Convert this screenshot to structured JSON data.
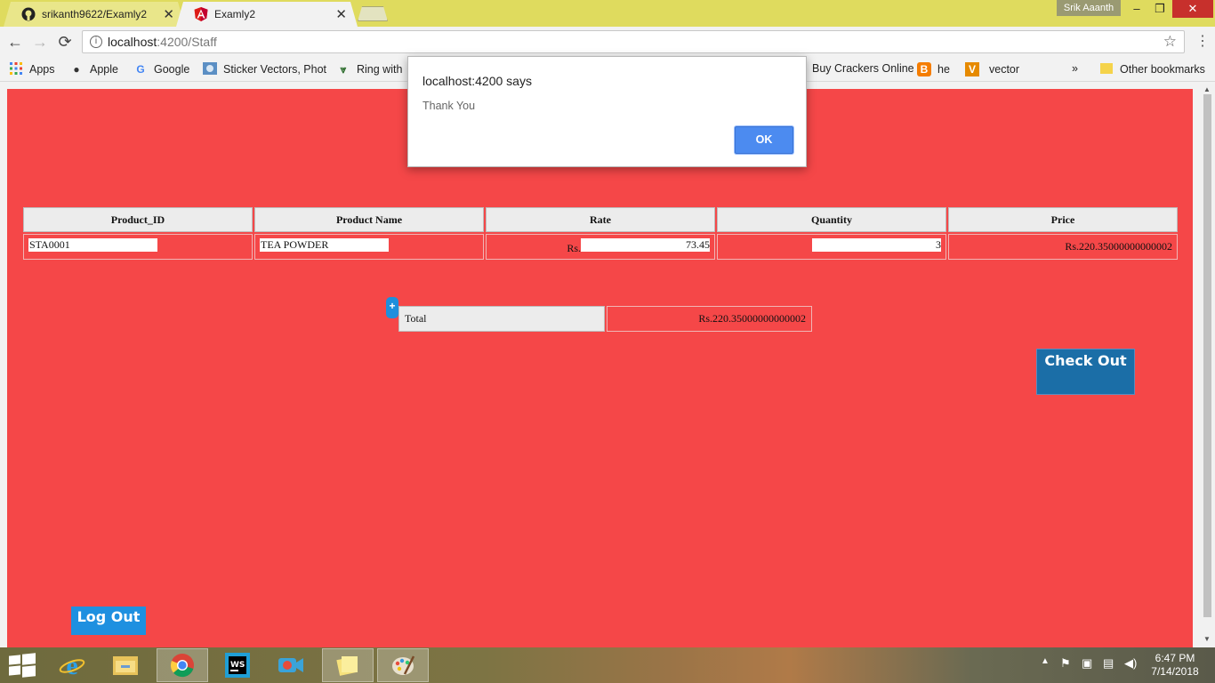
{
  "browser": {
    "tabs": [
      {
        "title": "srikanth9622/Examly2",
        "icon": "github-icon",
        "active": false
      },
      {
        "title": "Examly2",
        "icon": "angular-icon",
        "active": true
      }
    ],
    "close_glyph": "✕",
    "profile_name": "Srik Aaanth",
    "window_controls": {
      "minimize": "–",
      "maximize": "❐",
      "close": "✕"
    },
    "address": {
      "host": "localhost",
      "path": ":4200/Staff"
    },
    "nav": {
      "back": "←",
      "forward": "→",
      "reload": "⟳"
    }
  },
  "bookmarks": {
    "items": [
      {
        "label": "Apps",
        "icon": "apps-grid-icon"
      },
      {
        "label": "Apple",
        "icon": "apple-icon"
      },
      {
        "label": "Google",
        "icon": "google-icon"
      },
      {
        "label": "Sticker Vectors, Phot",
        "icon": "image-icon"
      },
      {
        "label": "Ring with",
        "icon": "vector-v-icon"
      },
      {
        "label": "Buy Crackers Online",
        "icon": ""
      },
      {
        "label": "he",
        "icon": "blogger-icon"
      },
      {
        "label": "vector",
        "icon": "v-icon"
      }
    ],
    "overflow": "»",
    "other_label": "Other bookmarks"
  },
  "dialog": {
    "title": "localhost:4200 says",
    "message": "Thank You",
    "ok_label": "OK"
  },
  "table": {
    "headers": [
      "Product_ID",
      "Product Name",
      "Rate",
      "Quantity",
      "Price"
    ],
    "rows": [
      {
        "product_id": "STA0001",
        "product_name": "TEA POWDER",
        "rate_prefix": "Rs.",
        "rate": "73.45",
        "quantity": "3",
        "price": "Rs.220.35000000000002"
      }
    ]
  },
  "add_button": "+",
  "total": {
    "label": "Total",
    "value": "Rs.220.35000000000002"
  },
  "buttons": {
    "checkout": "Check Out",
    "logout": "Log Out"
  },
  "taskbar": {
    "apps": [
      "internet-explorer-icon",
      "file-explorer-icon",
      "chrome-icon",
      "webstorm-icon",
      "video-icon",
      "sticky-notes-icon",
      "paint-icon"
    ],
    "time": "6:47 PM",
    "date": "7/14/2018"
  },
  "colors": {
    "page_bg": "#f54748",
    "checkout_bg": "#1b6ea7",
    "logout_bg": "#1e90e0",
    "ok_bg": "#4c8bf0"
  }
}
